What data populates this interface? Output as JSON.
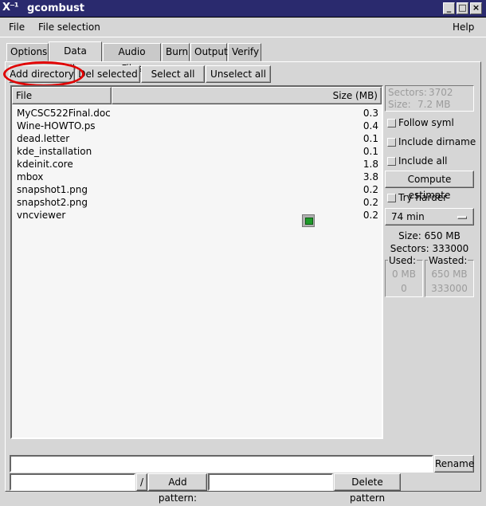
{
  "window": {
    "title": "gcombust",
    "buttons": [
      "_",
      "□",
      "×"
    ]
  },
  "menubar": {
    "file": "File",
    "file_selection": "File selection",
    "help": "Help"
  },
  "tabs": [
    {
      "label": "Options"
    },
    {
      "label": "Data Files"
    },
    {
      "label": "Audio Files"
    },
    {
      "label": "Burn"
    },
    {
      "label": "Output"
    },
    {
      "label": "Verify"
    }
  ],
  "toolbar": {
    "add_directory": "Add directory",
    "del_selected": "Del selected",
    "select_all": "Select all",
    "unselect_all": "Unselect all"
  },
  "filelist": {
    "col_file": "File",
    "col_size": "Size (MB)",
    "rows": [
      {
        "name": "MyCSC522Final.doc",
        "size": "0.3"
      },
      {
        "name": "Wine-HOWTO.ps",
        "size": "0.4"
      },
      {
        "name": "dead.letter",
        "size": "0.1"
      },
      {
        "name": "kde_installation",
        "size": "0.1"
      },
      {
        "name": "kdeinit.core",
        "size": "1.8"
      },
      {
        "name": "mbox",
        "size": "3.8"
      },
      {
        "name": "snapshot1.png",
        "size": "0.2"
      },
      {
        "name": "snapshot2.png",
        "size": "0.2"
      },
      {
        "name": "vncviewer",
        "size": "0.2"
      }
    ]
  },
  "side": {
    "sectors_label": "Sectors:",
    "sectors_value": "3702",
    "size_label": "Size:",
    "size_value": "7.2 MB",
    "follow_syml": "Follow syml",
    "include_dirname": "Include dirname",
    "include_all": "Include all",
    "compute_estimate": "Compute estimate",
    "try_harder": "Try harder",
    "cd_length": "74 min",
    "disk_size": "Size: 650 MB",
    "disk_sectors": "Sectors: 333000",
    "used_label": "Used:",
    "used_mb": "0 MB",
    "used_sectors": "0",
    "wasted_label": "Wasted:",
    "wasted_mb": "650 MB",
    "wasted_sectors": "333000"
  },
  "bottom": {
    "rename_value": "",
    "rename_button": "Rename",
    "dir_value": "",
    "slash": "/",
    "add_pattern_button": "Add pattern:",
    "pattern_value": "",
    "delete_pattern_button": "Delete pattern"
  },
  "colors": {
    "titlebar": "#2a2a6e",
    "highlight_circle": "#e00000",
    "cursor_icon": "#1f9a2a"
  },
  "icons": [
    "window-menu-icon",
    "minimize-icon",
    "maximize-icon",
    "close-icon",
    "option-menu-indicator-icon",
    "cursor-icon"
  ]
}
